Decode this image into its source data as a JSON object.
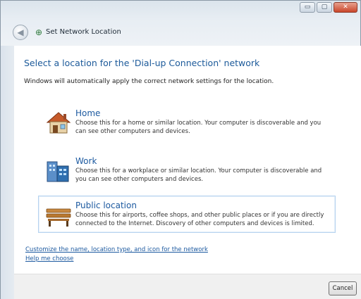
{
  "window": {
    "title": "Set Network Location",
    "caption": {
      "minimize": "▭",
      "maximize": "▢",
      "close": "✕"
    },
    "back_glyph": "◀",
    "net_glyph": "⊕"
  },
  "main": {
    "heading": "Select a location for the 'Dial-up Connection' network",
    "subtext": "Windows will automatically apply the correct network settings for the location.",
    "options": [
      {
        "icon": "home-icon",
        "title": "Home",
        "description": "Choose this for a home or similar location. Your computer is discoverable and you can see other computers and devices."
      },
      {
        "icon": "work-icon",
        "title": "Work",
        "description": "Choose this for a workplace or similar location. Your computer is discoverable and you can see other computers and devices."
      },
      {
        "icon": "public-bench-icon",
        "title": "Public location",
        "description": "Choose this for airports, coffee shops, and other public places or if you are directly connected to the Internet. Discovery of other computers and devices is limited."
      }
    ],
    "links": {
      "customize": "Customize the name, location type, and icon for the network",
      "help": "Help me choose"
    }
  },
  "footer": {
    "cancel_label": "Cancel"
  },
  "colors": {
    "accent": "#1d5aa0",
    "link": "#1d5aa0",
    "close": "#c9452a"
  }
}
